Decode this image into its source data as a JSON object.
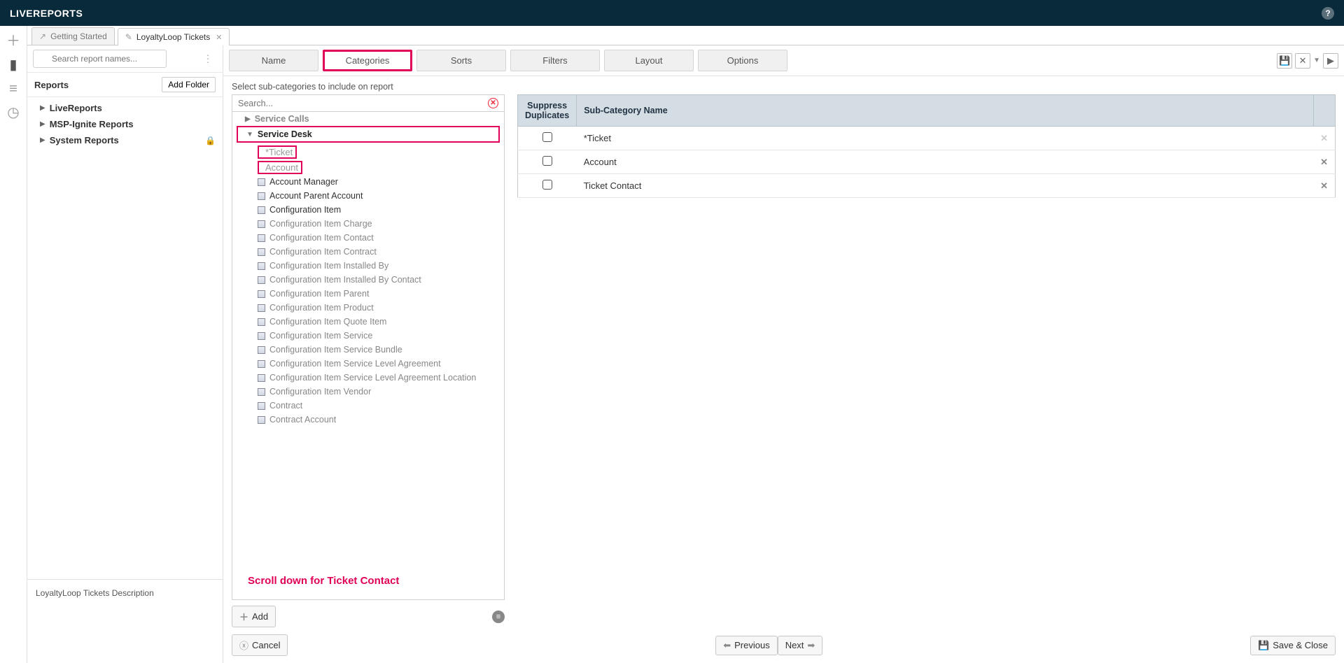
{
  "header": {
    "title": "LIVEREPORTS"
  },
  "tabs": [
    {
      "label": "Getting Started",
      "closable": false,
      "icon": "↗"
    },
    {
      "label": "LoyaltyLoop Tickets",
      "closable": true,
      "icon": "✎"
    }
  ],
  "search": {
    "placeholder": "Search report names..."
  },
  "reports_panel": {
    "title": "Reports",
    "add_folder_label": "Add Folder",
    "folders": [
      {
        "label": "LiveReports",
        "locked": false
      },
      {
        "label": "MSP-Ignite Reports",
        "locked": false
      },
      {
        "label": "System Reports",
        "locked": true
      }
    ]
  },
  "description": "LoyaltyLoop Tickets Description",
  "config_tabs": {
    "items": [
      "Name",
      "Categories",
      "Sorts",
      "Filters",
      "Layout",
      "Options"
    ],
    "active": "Categories"
  },
  "instructions": "Select sub-categories to include on report",
  "tree_search": {
    "placeholder": "Search..."
  },
  "tree": {
    "groups": [
      {
        "label": "Service Calls",
        "expanded": false,
        "active": false
      },
      {
        "label": "Service Desk",
        "expanded": true,
        "active": true,
        "children": [
          {
            "label": "*Ticket",
            "highlight": true,
            "muted": true
          },
          {
            "label": "Account",
            "highlight": true,
            "muted": true
          },
          {
            "label": "Account Manager",
            "highlight": false,
            "muted": false
          },
          {
            "label": "Account Parent Account",
            "highlight": false,
            "muted": false
          },
          {
            "label": "Configuration Item",
            "highlight": false,
            "muted": false
          },
          {
            "label": "Configuration Item Charge",
            "highlight": false,
            "muted": true
          },
          {
            "label": "Configuration Item Contact",
            "highlight": false,
            "muted": true
          },
          {
            "label": "Configuration Item Contract",
            "highlight": false,
            "muted": true
          },
          {
            "label": "Configuration Item Installed By",
            "highlight": false,
            "muted": true
          },
          {
            "label": "Configuration Item Installed By Contact",
            "highlight": false,
            "muted": true
          },
          {
            "label": "Configuration Item Parent",
            "highlight": false,
            "muted": true
          },
          {
            "label": "Configuration Item Product",
            "highlight": false,
            "muted": true
          },
          {
            "label": "Configuration Item Quote Item",
            "highlight": false,
            "muted": true
          },
          {
            "label": "Configuration Item Service",
            "highlight": false,
            "muted": true
          },
          {
            "label": "Configuration Item Service Bundle",
            "highlight": false,
            "muted": true
          },
          {
            "label": "Configuration Item Service Level Agreement",
            "highlight": false,
            "muted": true
          },
          {
            "label": "Configuration Item Service Level Agreement Location",
            "highlight": false,
            "muted": true
          },
          {
            "label": "Configuration Item Vendor",
            "highlight": false,
            "muted": true
          },
          {
            "label": "Contract",
            "highlight": false,
            "muted": true
          },
          {
            "label": "Contract Account",
            "highlight": false,
            "muted": true
          }
        ]
      }
    ]
  },
  "scroll_hint": "Scroll down for Ticket Contact",
  "add_label": "Add",
  "cancel_label": "Cancel",
  "selected_table": {
    "headers": {
      "suppress": "Suppress Duplicates",
      "name": "Sub-Category Name"
    },
    "rows": [
      {
        "name": "*Ticket",
        "removable": false
      },
      {
        "name": "Account",
        "removable": true
      },
      {
        "name": "Ticket Contact",
        "removable": true
      }
    ]
  },
  "footer": {
    "previous": "Previous",
    "next": "Next",
    "save_close": "Save & Close"
  }
}
